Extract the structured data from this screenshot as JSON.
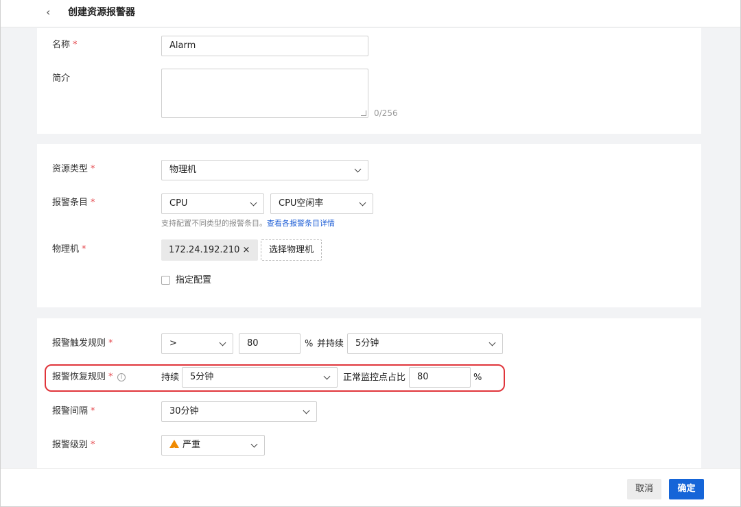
{
  "header": {
    "title": "创建资源报警器"
  },
  "basic": {
    "name_label": "名称",
    "name_value": "Alarm",
    "desc_label": "简介",
    "desc_counter": "0/256"
  },
  "resource": {
    "type_label": "资源类型",
    "type_value": "物理机",
    "item_label": "报警条目",
    "item_value_1": "CPU",
    "item_value_2": "CPU空闲率",
    "hint_text": "支持配置不同类型的报警条目。",
    "hint_link": "查看各报警条目详情",
    "machine_label": "物理机",
    "machine_tag": "172.24.192.210",
    "machine_tag_close": "×",
    "select_machine_btn": "选择物理机",
    "specify_config_label": "指定配置"
  },
  "rules": {
    "trigger_label": "报警触发规则",
    "trigger_op": ">",
    "trigger_value": "80",
    "trigger_unit": "%",
    "trigger_duration_label": "并持续",
    "trigger_duration": "5分钟",
    "recover_label": "报警恢复规则",
    "recover_duration_label": "持续",
    "recover_duration": "5分钟",
    "recover_ratio_label": "正常监控点占比",
    "recover_ratio_value": "80",
    "recover_ratio_unit": "%",
    "interval_label": "报警间隔",
    "interval_value": "30分钟",
    "level_label": "报警级别",
    "level_value": "严重"
  },
  "footer": {
    "cancel": "取消",
    "confirm": "确定"
  },
  "colors": {
    "primary": "#1565d8",
    "required": "#e5484d",
    "highlight": "#e0343a",
    "warning": "#f08a00"
  }
}
